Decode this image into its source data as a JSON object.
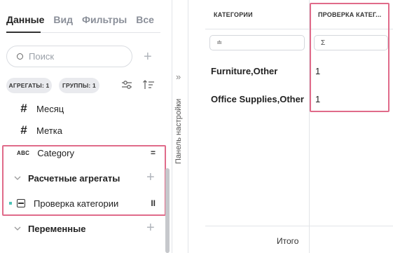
{
  "tabs": [
    "Данные",
    "Вид",
    "Фильтры",
    "Все"
  ],
  "search": {
    "placeholder": "Поиск"
  },
  "chips": [
    "АГРЕГАТЫ: 1",
    "ГРУППЫ: 1"
  ],
  "fields": [
    {
      "icon": "#",
      "label": "Месяц"
    },
    {
      "icon": "#",
      "label": "Метка"
    },
    {
      "icon": "ABC",
      "label": "Category",
      "mark": "="
    }
  ],
  "sections": {
    "calc_aggregates": "Расчетные агрегаты",
    "variables": "Переменные"
  },
  "calc_field": {
    "label": "Проверка категории",
    "mark": "II"
  },
  "collapsed_panel": {
    "label": "Панель настройки",
    "arrows": "»"
  },
  "table": {
    "columns": [
      "КАТЕГОРИИ",
      "ПРОВЕРКА КАТЕГ..."
    ],
    "filter_icons": [
      "≐",
      "Σ"
    ],
    "rows": [
      {
        "category": "Furniture,Other",
        "check": "1"
      },
      {
        "category": "Office Supplies,Other",
        "check": "1"
      }
    ],
    "total_label": "Итого"
  },
  "colors": {
    "highlight": "#e06b8a",
    "accent_dot": "#4ec2b7"
  }
}
